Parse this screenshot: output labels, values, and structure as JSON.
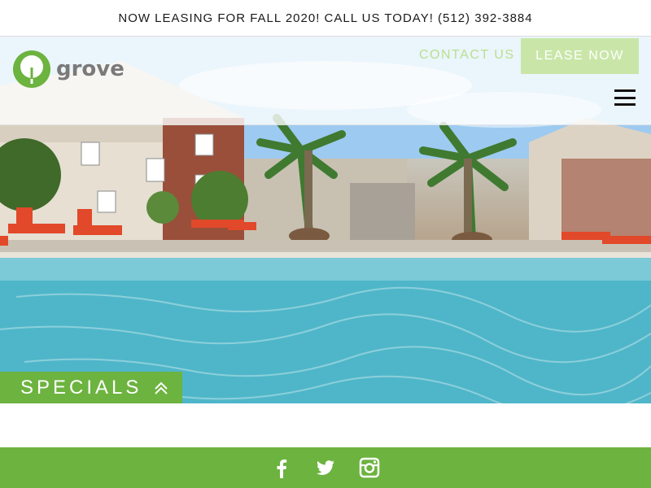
{
  "announcement": {
    "text": "NOW LEASING FOR FALL 2020! CALL US TODAY! (512) 392-3884"
  },
  "header": {
    "logo_text": "grove",
    "contact_label": "CONTACT US",
    "lease_label": "LEASE NOW"
  },
  "specials": {
    "label": "SPECIALS",
    "icon": "double-chevron-up-icon"
  },
  "footer": {
    "social": [
      {
        "name": "facebook-icon"
      },
      {
        "name": "twitter-icon"
      },
      {
        "name": "instagram-icon"
      }
    ]
  },
  "colors": {
    "brand_green": "#6cb33f",
    "light_green": "#c9e6a8",
    "text_dark": "#1a1a1a"
  }
}
